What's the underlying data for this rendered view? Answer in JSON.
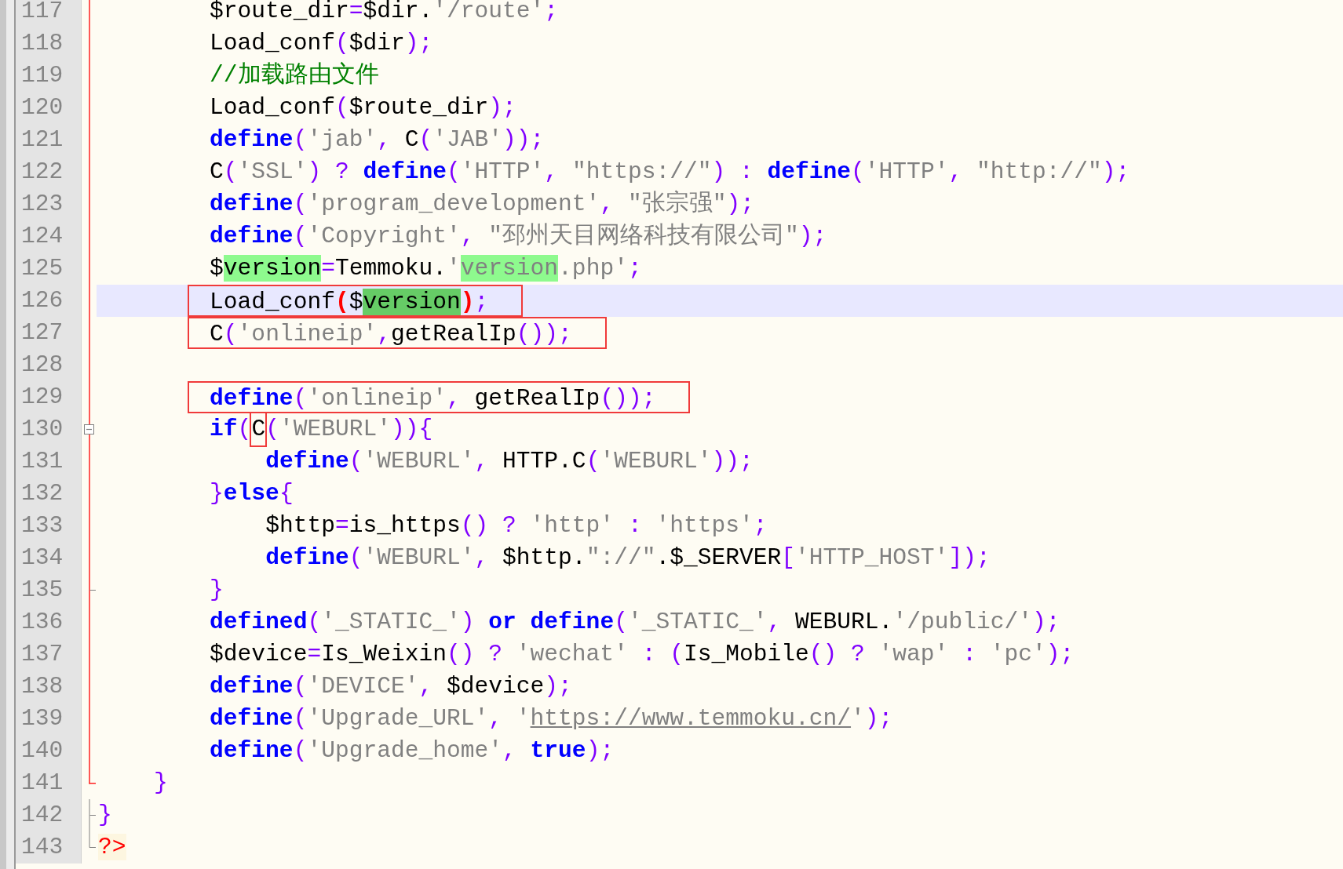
{
  "lines": [
    {
      "number": "117",
      "fold": {
        "kind": "line"
      },
      "current": false,
      "boxed": false,
      "tokens": [
        {
          "text": "        $route_dir",
          "kind": "plain"
        },
        {
          "text": "=",
          "kind": "op"
        },
        {
          "text": "$dir.",
          "kind": "plain"
        },
        {
          "text": "'/route'",
          "kind": "string"
        },
        {
          "text": ";",
          "kind": "op"
        }
      ]
    },
    {
      "number": "118",
      "fold": {
        "kind": "line"
      },
      "current": false,
      "boxed": false,
      "tokens": [
        {
          "text": "        Load_conf",
          "kind": "plain"
        },
        {
          "text": "(",
          "kind": "op"
        },
        {
          "text": "$dir",
          "kind": "plain"
        },
        {
          "text": ");",
          "kind": "op"
        }
      ]
    },
    {
      "number": "119",
      "fold": {
        "kind": "line"
      },
      "current": false,
      "boxed": false,
      "tokens": [
        {
          "text": "        //加载路由文件",
          "kind": "comment"
        }
      ]
    },
    {
      "number": "120",
      "fold": {
        "kind": "line"
      },
      "current": false,
      "boxed": false,
      "tokens": [
        {
          "text": "        Load_conf",
          "kind": "plain"
        },
        {
          "text": "(",
          "kind": "op"
        },
        {
          "text": "$route_dir",
          "kind": "plain"
        },
        {
          "text": ");",
          "kind": "op"
        }
      ]
    },
    {
      "number": "121",
      "fold": {
        "kind": "line"
      },
      "current": false,
      "boxed": false,
      "tokens": [
        {
          "text": "        define",
          "kind": "keyword"
        },
        {
          "text": "(",
          "kind": "op"
        },
        {
          "text": "'jab'",
          "kind": "string"
        },
        {
          "text": ", ",
          "kind": "op"
        },
        {
          "text": "C",
          "kind": "plain"
        },
        {
          "text": "(",
          "kind": "op"
        },
        {
          "text": "'JAB'",
          "kind": "string"
        },
        {
          "text": "));",
          "kind": "op"
        }
      ]
    },
    {
      "number": "122",
      "fold": {
        "kind": "line"
      },
      "current": false,
      "boxed": false,
      "tokens": [
        {
          "text": "        C",
          "kind": "plain"
        },
        {
          "text": "(",
          "kind": "op"
        },
        {
          "text": "'SSL'",
          "kind": "string"
        },
        {
          "text": ") ? ",
          "kind": "op"
        },
        {
          "text": "define",
          "kind": "keyword"
        },
        {
          "text": "(",
          "kind": "op"
        },
        {
          "text": "'HTTP'",
          "kind": "string"
        },
        {
          "text": ", ",
          "kind": "op"
        },
        {
          "text": "\"https://\"",
          "kind": "string"
        },
        {
          "text": ") : ",
          "kind": "op"
        },
        {
          "text": "define",
          "kind": "keyword"
        },
        {
          "text": "(",
          "kind": "op"
        },
        {
          "text": "'HTTP'",
          "kind": "string"
        },
        {
          "text": ", ",
          "kind": "op"
        },
        {
          "text": "\"http://\"",
          "kind": "string"
        },
        {
          "text": ");",
          "kind": "op"
        }
      ]
    },
    {
      "number": "123",
      "fold": {
        "kind": "line"
      },
      "current": false,
      "boxed": false,
      "tokens": [
        {
          "text": "        define",
          "kind": "keyword"
        },
        {
          "text": "(",
          "kind": "op"
        },
        {
          "text": "'program_development'",
          "kind": "string"
        },
        {
          "text": ", ",
          "kind": "op"
        },
        {
          "text": "\"张宗强\"",
          "kind": "string"
        },
        {
          "text": ");",
          "kind": "op"
        }
      ]
    },
    {
      "number": "124",
      "fold": {
        "kind": "line"
      },
      "current": false,
      "boxed": false,
      "tokens": [
        {
          "text": "        define",
          "kind": "keyword"
        },
        {
          "text": "(",
          "kind": "op"
        },
        {
          "text": "'Copyright'",
          "kind": "string"
        },
        {
          "text": ", ",
          "kind": "op"
        },
        {
          "text": "\"邳州天目网络科技有限公司\"",
          "kind": "string"
        },
        {
          "text": ");",
          "kind": "op"
        }
      ]
    },
    {
      "number": "125",
      "fold": {
        "kind": "line"
      },
      "current": false,
      "boxed": false,
      "tokens": [
        {
          "text": "        $",
          "kind": "plain"
        },
        {
          "text": "version",
          "kind": "match"
        },
        {
          "text": "=",
          "kind": "op"
        },
        {
          "text": "Temmoku.",
          "kind": "plain"
        },
        {
          "text": "'",
          "kind": "string"
        },
        {
          "text": "version",
          "kind": "string_match"
        },
        {
          "text": ".php'",
          "kind": "string"
        },
        {
          "text": ";",
          "kind": "op"
        }
      ]
    },
    {
      "number": "126",
      "fold": {
        "kind": "line"
      },
      "current": true,
      "boxed": true,
      "tokens": [
        {
          "text": "        Load_conf",
          "kind": "plain"
        },
        {
          "text": "(",
          "kind": "brace_match"
        },
        {
          "text": "$",
          "kind": "plain"
        },
        {
          "text": "version",
          "kind": "selection"
        },
        {
          "text": ")",
          "kind": "brace_match"
        },
        {
          "text": ";",
          "kind": "op"
        }
      ]
    },
    {
      "number": "127",
      "fold": {
        "kind": "line"
      },
      "current": false,
      "boxed": true,
      "tokens": [
        {
          "text": "        C",
          "kind": "plain"
        },
        {
          "text": "(",
          "kind": "op"
        },
        {
          "text": "'onlineip'",
          "kind": "string"
        },
        {
          "text": ",",
          "kind": "op"
        },
        {
          "text": "getRealIp",
          "kind": "plain"
        },
        {
          "text": "());",
          "kind": "op"
        }
      ]
    },
    {
      "number": "128",
      "fold": {
        "kind": "line"
      },
      "current": false,
      "boxed": false
    },
    {
      "number": "129",
      "fold": {
        "kind": "line"
      },
      "current": false,
      "boxed": true,
      "tokens": [
        {
          "text": "        define",
          "kind": "keyword"
        },
        {
          "text": "(",
          "kind": "op"
        },
        {
          "text": "'onlineip'",
          "kind": "string"
        },
        {
          "text": ", ",
          "kind": "op"
        },
        {
          "text": "getRealIp",
          "kind": "plain"
        },
        {
          "text": "());",
          "kind": "op"
        }
      ]
    },
    {
      "number": "130",
      "fold": {
        "kind": "box"
      },
      "current": false,
      "boxed": false,
      "tokens": [
        {
          "text": "        if",
          "kind": "keyword"
        },
        {
          "text": "(",
          "kind": "op"
        },
        {
          "text": "C",
          "kind": "boxed"
        },
        {
          "text": "(",
          "kind": "op"
        },
        {
          "text": "'WEBURL'",
          "kind": "string"
        },
        {
          "text": ")){",
          "kind": "op"
        }
      ]
    },
    {
      "number": "131",
      "fold": {
        "kind": "line"
      },
      "current": false,
      "boxed": false,
      "tokens": [
        {
          "text": "            define",
          "kind": "keyword"
        },
        {
          "text": "(",
          "kind": "op"
        },
        {
          "text": "'WEBURL'",
          "kind": "string"
        },
        {
          "text": ", ",
          "kind": "op"
        },
        {
          "text": "HTTP.C",
          "kind": "plain"
        },
        {
          "text": "(",
          "kind": "op"
        },
        {
          "text": "'WEBURL'",
          "kind": "string"
        },
        {
          "text": "));",
          "kind": "op"
        }
      ]
    },
    {
      "number": "132",
      "fold": {
        "kind": "line"
      },
      "current": false,
      "boxed": false,
      "tokens": [
        {
          "text": "        }",
          "kind": "op"
        },
        {
          "text": "else",
          "kind": "keyword"
        },
        {
          "text": "{",
          "kind": "op"
        }
      ]
    },
    {
      "number": "133",
      "fold": {
        "kind": "line"
      },
      "current": false,
      "boxed": false,
      "tokens": [
        {
          "text": "            $http",
          "kind": "plain"
        },
        {
          "text": "=",
          "kind": "op"
        },
        {
          "text": "is_https",
          "kind": "plain"
        },
        {
          "text": "() ? ",
          "kind": "op"
        },
        {
          "text": "'http'",
          "kind": "string"
        },
        {
          "text": " : ",
          "kind": "op"
        },
        {
          "text": "'https'",
          "kind": "string"
        },
        {
          "text": ";",
          "kind": "op"
        }
      ]
    },
    {
      "number": "134",
      "fold": {
        "kind": "line"
      },
      "current": false,
      "boxed": false,
      "tokens": [
        {
          "text": "            define",
          "kind": "keyword"
        },
        {
          "text": "(",
          "kind": "op"
        },
        {
          "text": "'WEBURL'",
          "kind": "string"
        },
        {
          "text": ", ",
          "kind": "op"
        },
        {
          "text": "$http.",
          "kind": "plain"
        },
        {
          "text": "\"://\"",
          "kind": "string"
        },
        {
          "text": ".$_SERVER",
          "kind": "plain"
        },
        {
          "text": "[",
          "kind": "op"
        },
        {
          "text": "'HTTP_HOST'",
          "kind": "string"
        },
        {
          "text": "]);",
          "kind": "op"
        }
      ]
    },
    {
      "number": "135",
      "fold": {
        "kind": "tick"
      },
      "current": false,
      "boxed": false,
      "tokens": [
        {
          "text": "        }",
          "kind": "op"
        }
      ]
    },
    {
      "number": "136",
      "fold": {
        "kind": "line"
      },
      "current": false,
      "boxed": false,
      "tokens": [
        {
          "text": "        defined",
          "kind": "keyword"
        },
        {
          "text": "(",
          "kind": "op"
        },
        {
          "text": "'_STATIC_'",
          "kind": "string"
        },
        {
          "text": ") ",
          "kind": "op"
        },
        {
          "text": "or",
          "kind": "keyword"
        },
        {
          "text": " define",
          "kind": "keyword"
        },
        {
          "text": "(",
          "kind": "op"
        },
        {
          "text": "'_STATIC_'",
          "kind": "string"
        },
        {
          "text": ", ",
          "kind": "op"
        },
        {
          "text": "WEBURL.",
          "kind": "plain"
        },
        {
          "text": "'/public/'",
          "kind": "string"
        },
        {
          "text": ");",
          "kind": "op"
        }
      ]
    },
    {
      "number": "137",
      "fold": {
        "kind": "line"
      },
      "current": false,
      "boxed": false,
      "tokens": [
        {
          "text": "        $device",
          "kind": "plain"
        },
        {
          "text": "=",
          "kind": "op"
        },
        {
          "text": "Is_Weixin",
          "kind": "plain"
        },
        {
          "text": "() ? ",
          "kind": "op"
        },
        {
          "text": "'wechat'",
          "kind": "string"
        },
        {
          "text": " : (",
          "kind": "op"
        },
        {
          "text": "Is_Mobile",
          "kind": "plain"
        },
        {
          "text": "() ? ",
          "kind": "op"
        },
        {
          "text": "'wap'",
          "kind": "string"
        },
        {
          "text": " : ",
          "kind": "op"
        },
        {
          "text": "'pc'",
          "kind": "string"
        },
        {
          "text": ");",
          "kind": "op"
        }
      ]
    },
    {
      "number": "138",
      "fold": {
        "kind": "line"
      },
      "current": false,
      "boxed": false,
      "tokens": [
        {
          "text": "        define",
          "kind": "keyword"
        },
        {
          "text": "(",
          "kind": "op"
        },
        {
          "text": "'DEVICE'",
          "kind": "string"
        },
        {
          "text": ", ",
          "kind": "op"
        },
        {
          "text": "$device",
          "kind": "plain"
        },
        {
          "text": ");",
          "kind": "op"
        }
      ]
    },
    {
      "number": "139",
      "fold": {
        "kind": "line"
      },
      "current": false,
      "boxed": false,
      "tokens": [
        {
          "text": "        define",
          "kind": "keyword"
        },
        {
          "text": "(",
          "kind": "op"
        },
        {
          "text": "'Upgrade_URL'",
          "kind": "string"
        },
        {
          "text": ", ",
          "kind": "op"
        },
        {
          "text": "'",
          "kind": "string"
        },
        {
          "text": "https://www.temmoku.cn/",
          "kind": "link"
        },
        {
          "text": "'",
          "kind": "string"
        },
        {
          "text": ");",
          "kind": "op"
        }
      ]
    },
    {
      "number": "140",
      "fold": {
        "kind": "line"
      },
      "current": false,
      "boxed": false,
      "tokens": [
        {
          "text": "        define",
          "kind": "keyword"
        },
        {
          "text": "(",
          "kind": "op"
        },
        {
          "text": "'Upgrade_home'",
          "kind": "string"
        },
        {
          "text": ", ",
          "kind": "op"
        },
        {
          "text": "true",
          "kind": "keyword"
        },
        {
          "text": ");",
          "kind": "op"
        }
      ]
    },
    {
      "number": "141",
      "fold": {
        "kind": "end"
      },
      "current": false,
      "boxed": false,
      "tokens": [
        {
          "text": "    }",
          "kind": "op"
        }
      ]
    },
    {
      "number": "142",
      "fold": {
        "kind": "gray_tick"
      },
      "current": false,
      "boxed": false,
      "tokens": [
        {
          "text": "}",
          "kind": "op"
        }
      ]
    },
    {
      "number": "143",
      "fold": {
        "kind": "gray_end"
      },
      "current": false,
      "boxed": false,
      "tokens": [
        {
          "text": "?>",
          "kind": "tag"
        }
      ]
    }
  ]
}
